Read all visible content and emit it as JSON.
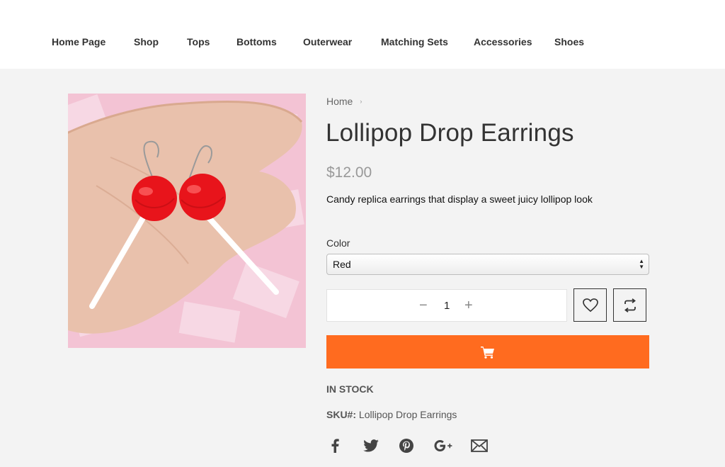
{
  "nav": {
    "items": [
      {
        "label": "Home Page"
      },
      {
        "label": "Shop"
      },
      {
        "label": "Tops"
      },
      {
        "label": "Bottoms"
      },
      {
        "label": "Outerwear"
      },
      {
        "label": "Matching Sets"
      },
      {
        "label": "Accessories"
      },
      {
        "label": "Shoes"
      }
    ]
  },
  "breadcrumb": {
    "home": "Home",
    "separator": "›"
  },
  "product": {
    "title": "Lollipop Drop Earrings",
    "price": "$12.00",
    "description": "Candy replica earrings that display a sweet juicy lollipop look",
    "color_label": "Color",
    "color_selected": "Red",
    "quantity": "1",
    "minus_symbol": "−",
    "plus_symbol": "+",
    "stock_status": "IN STOCK",
    "sku_label": "SKU#:",
    "sku_value": "Lollipop Drop Earrings"
  },
  "icons": {
    "wishlist": "heart-icon",
    "compare": "compare-arrows-icon",
    "cart": "cart-icon",
    "social": [
      "facebook-icon",
      "twitter-icon",
      "pinterest-icon",
      "google-plus-icon",
      "email-icon"
    ]
  },
  "colors": {
    "accent": "#ff6b1f",
    "background": "#f3f3f3",
    "header": "#ffffff",
    "text": "#333333",
    "price": "#999999"
  }
}
